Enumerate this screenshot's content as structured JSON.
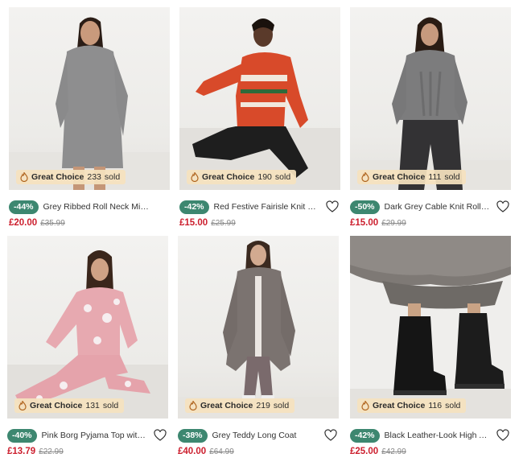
{
  "badge_common": {
    "label": "Great Choice",
    "suffix": "sold"
  },
  "products": [
    {
      "discount": "-44%",
      "title": "Grey Ribbed Roll Neck Mini J...",
      "price": "£20.00",
      "was_price": "£35.99",
      "sold_count": "233",
      "has_heart": false
    },
    {
      "discount": "-42%",
      "title": "Red Festive Fairisle Knit Famil...",
      "price": "£15.00",
      "was_price": "£25.99",
      "sold_count": "190",
      "has_heart": true
    },
    {
      "discount": "-50%",
      "title": "Dark Grey Cable Knit Roll Nec...",
      "price": "£15.00",
      "was_price": "£29.99",
      "sold_count": "111",
      "has_heart": true
    },
    {
      "discount": "-40%",
      "title": "Pink Borg Pyjama Top with An...",
      "price": "£13.79",
      "was_price": "£22.99",
      "sold_count": "131",
      "has_heart": true
    },
    {
      "discount": "-38%",
      "title": "Grey Teddy Long Coat",
      "price": "£40.00",
      "was_price": "£64.99",
      "sold_count": "219",
      "has_heart": true
    },
    {
      "discount": "-42%",
      "title": "Black Leather-Look High Ankl...",
      "price": "£25.00",
      "was_price": "£42.99",
      "sold_count": "116",
      "has_heart": true
    }
  ],
  "icons": {
    "badge": "flame-icon",
    "wishlist": "heart-outline-icon"
  },
  "colors": {
    "discount_bg": "#3d8770",
    "price": "#cc1f2e",
    "badge_bg": "#f5e2be"
  }
}
